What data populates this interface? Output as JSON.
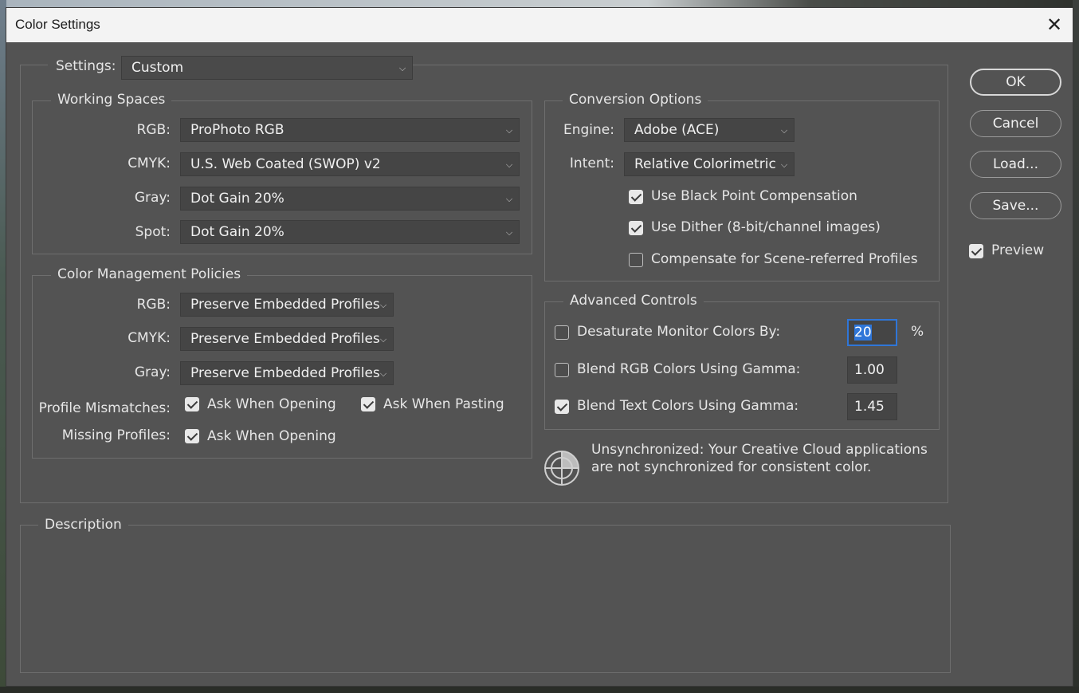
{
  "window": {
    "title": "Color Settings",
    "close_glyph": "✕"
  },
  "settings": {
    "label": "Settings:",
    "value": "Custom"
  },
  "working_spaces": {
    "title": "Working Spaces",
    "rgb": {
      "label": "RGB:",
      "value": "ProPhoto RGB"
    },
    "cmyk": {
      "label": "CMYK:",
      "value": "U.S. Web Coated (SWOP) v2"
    },
    "gray": {
      "label": "Gray:",
      "value": "Dot Gain 20%"
    },
    "spot": {
      "label": "Spot:",
      "value": "Dot Gain 20%"
    }
  },
  "policies": {
    "title": "Color Management Policies",
    "rgb": {
      "label": "RGB:",
      "value": "Preserve Embedded Profiles"
    },
    "cmyk": {
      "label": "CMYK:",
      "value": "Preserve Embedded Profiles"
    },
    "gray": {
      "label": "Gray:",
      "value": "Preserve Embedded Profiles"
    },
    "profile_mismatches": {
      "label": "Profile Mismatches:",
      "ask_opening": {
        "label": "Ask When Opening",
        "checked": true
      },
      "ask_pasting": {
        "label": "Ask When Pasting",
        "checked": true
      }
    },
    "missing_profiles": {
      "label": "Missing Profiles:",
      "ask_opening": {
        "label": "Ask When Opening",
        "checked": true
      }
    }
  },
  "conversion": {
    "title": "Conversion Options",
    "engine": {
      "label": "Engine:",
      "value": "Adobe (ACE)"
    },
    "intent": {
      "label": "Intent:",
      "value": "Relative Colorimetric"
    },
    "black_point": {
      "label": "Use Black Point Compensation",
      "checked": true
    },
    "dither": {
      "label": "Use Dither (8-bit/channel images)",
      "checked": true
    },
    "scene_referred": {
      "label": "Compensate for Scene-referred Profiles",
      "checked": false
    }
  },
  "advanced": {
    "title": "Advanced Controls",
    "desaturate": {
      "label": "Desaturate Monitor Colors By:",
      "checked": false,
      "value": "20",
      "unit": "%"
    },
    "blend_rgb": {
      "label": "Blend RGB Colors Using Gamma:",
      "checked": false,
      "value": "1.00"
    },
    "blend_text": {
      "label": "Blend Text Colors Using Gamma:",
      "checked": true,
      "value": "1.45"
    }
  },
  "sync": {
    "line1": "Unsynchronized: Your Creative Cloud applications",
    "line2": "are not synchronized for consistent color.",
    "icon": "sync-target-icon"
  },
  "description": {
    "title": "Description"
  },
  "buttons": {
    "ok": "OK",
    "cancel": "Cancel",
    "load": "Load...",
    "save": "Save..."
  },
  "preview": {
    "label": "Preview",
    "checked": true
  },
  "colors": {
    "dialog_bg": "#535353",
    "field_bg": "#454545",
    "focus": "#2f76d8"
  }
}
